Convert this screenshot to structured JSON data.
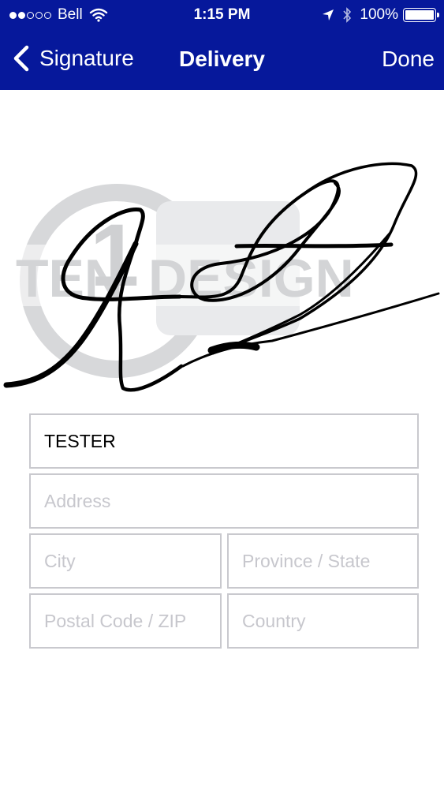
{
  "status_bar": {
    "carrier": "Bell",
    "signal_dots_filled": 2,
    "signal_dots_total": 5,
    "time": "1:15 PM",
    "battery": "100%",
    "icons": [
      "wifi-icon",
      "location-arrow-icon",
      "bluetooth-icon",
      "battery-icon"
    ]
  },
  "nav": {
    "back_label": "Signature",
    "title": "Delivery",
    "done_label": "Done",
    "background": "#06189b"
  },
  "form": {
    "name": {
      "value": "TESTER"
    },
    "address": {
      "placeholder": "Address"
    },
    "city": {
      "placeholder": "City"
    },
    "province": {
      "placeholder": "Province / State"
    },
    "postal": {
      "placeholder": "Postal Code / ZIP"
    },
    "country": {
      "placeholder": "Country"
    }
  },
  "watermark": {
    "text_left": "TEN",
    "text_right": "DESIGN",
    "mark": "1"
  }
}
